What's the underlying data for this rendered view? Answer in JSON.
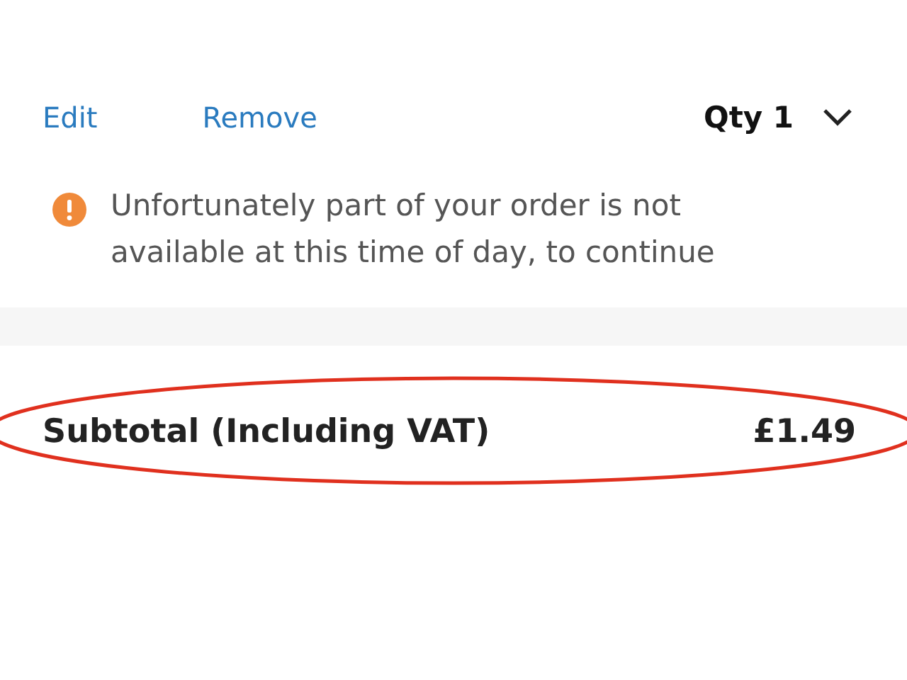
{
  "actions": [
    "Edit",
    "Remove"
  ],
  "quantity": {
    "label": "Qty 1"
  },
  "warning": {
    "text": "Unfortunately part of your order is not available at this time of day, to continue"
  },
  "subtotal": {
    "label": "Subtotal (Including VAT)",
    "value": "£1.49",
    "highlighted": true
  }
}
